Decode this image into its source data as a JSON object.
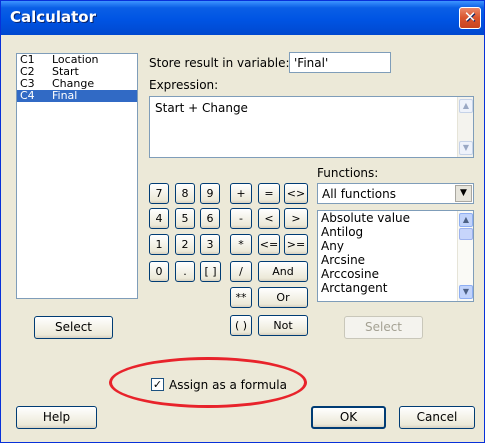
{
  "window": {
    "title": "Calculator",
    "close_glyph": "✕"
  },
  "columns": [
    {
      "id": "C1",
      "name": "Location",
      "selected": false
    },
    {
      "id": "C2",
      "name": "Start",
      "selected": false
    },
    {
      "id": "C3",
      "name": "Change",
      "selected": false
    },
    {
      "id": "C4",
      "name": "Final",
      "selected": true
    }
  ],
  "store": {
    "label": "Store result in variable:",
    "value": "'Final'"
  },
  "expression": {
    "label": "Expression:",
    "value": "Start + Change"
  },
  "keypad": {
    "k7": "7",
    "k8": "8",
    "k9": "9",
    "plus": "+",
    "eq": "=",
    "ne": "<>",
    "k4": "4",
    "k5": "5",
    "k6": "6",
    "minus": "-",
    "lt": "<",
    "gt": ">",
    "k1": "1",
    "k2": "2",
    "k3": "3",
    "mul": "*",
    "le": "<=",
    "ge": ">=",
    "k0": "0",
    "dot": ".",
    "brackets": "[ ]",
    "div": "/",
    "and": "And",
    "pow": "**",
    "or": "Or",
    "parens": "( )",
    "not": "Not"
  },
  "functions": {
    "label": "Functions:",
    "category": "All functions",
    "items": [
      "Absolute value",
      "Antilog",
      "Any",
      "Arcsine",
      "Arccosine",
      "Arctangent"
    ]
  },
  "buttons": {
    "select_left": "Select",
    "select_right": "Select",
    "help": "Help",
    "ok": "OK",
    "cancel": "Cancel"
  },
  "formula": {
    "label": "Assign as a formula",
    "checked": true,
    "check_glyph": "✓"
  },
  "glyphs": {
    "up": "▲",
    "down": "▼"
  },
  "colors": {
    "selection": "#316ac5",
    "highlight_ellipse": "#e8232b",
    "title_blue": "#0054e3"
  }
}
